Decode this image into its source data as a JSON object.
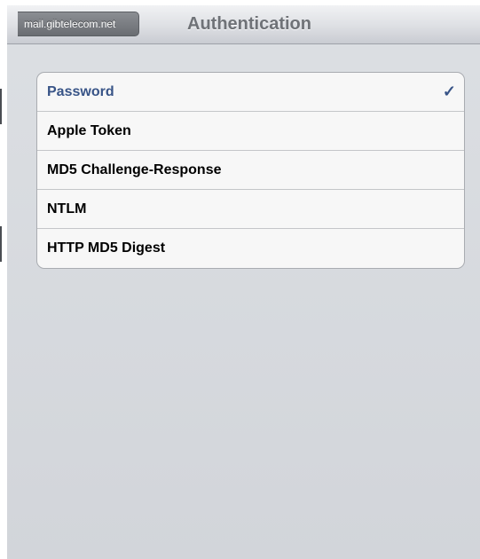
{
  "navbar": {
    "back_label": "mail.gibtelecom.net",
    "title": "Authentication"
  },
  "auth_options": [
    {
      "label": "Password",
      "selected": true
    },
    {
      "label": "Apple Token",
      "selected": false
    },
    {
      "label": "MD5 Challenge-Response",
      "selected": false
    },
    {
      "label": "NTLM",
      "selected": false
    },
    {
      "label": "HTTP MD5 Digest",
      "selected": false
    }
  ],
  "checkmark_glyph": "✓",
  "colors": {
    "selected_text": "#385487",
    "background": "#d6d9de",
    "back_button": "#7a7d82"
  },
  "icons": {
    "checkmark": "checkmark-icon"
  }
}
